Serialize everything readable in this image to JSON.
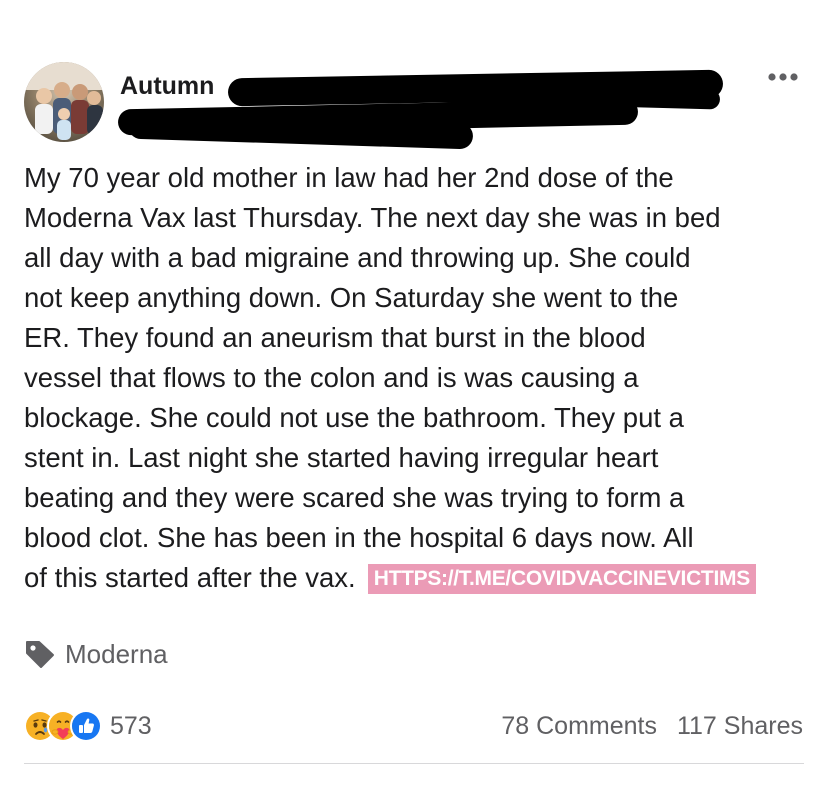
{
  "post": {
    "author_name": "Autumn",
    "author_redacted": true,
    "menu_icon": "more-horizontal-icon",
    "text_lines": [
      "My 70 year old mother in law had her 2nd dose of the",
      "Moderna Vax last Thursday. The next day she was in bed",
      "all day with a bad migraine and throwing up. She could",
      "not keep anything down. On Saturday she went to the",
      "ER. They found an aneurism that burst in the blood",
      "vessel that flows to the colon and is was causing a",
      "blockage. She could not use the bathroom. They put a",
      "stent in. Last night she started having irregular heart",
      "beating and they were scared she was trying to form a",
      "blood clot. She has been in the hospital 6 days now. All",
      "of this started after the vax."
    ],
    "watermark": "HTTPS://T.ME/COVIDVACCINEVICTIMS",
    "watermark_color": "#eb9bb6",
    "tag": {
      "icon": "tag-icon",
      "label": "Moderna"
    },
    "reactions": {
      "icons": [
        "sad-reaction-icon",
        "care-reaction-icon",
        "like-reaction-icon"
      ],
      "count": "573"
    },
    "comments": "78 Comments",
    "shares": "117 Shares"
  }
}
